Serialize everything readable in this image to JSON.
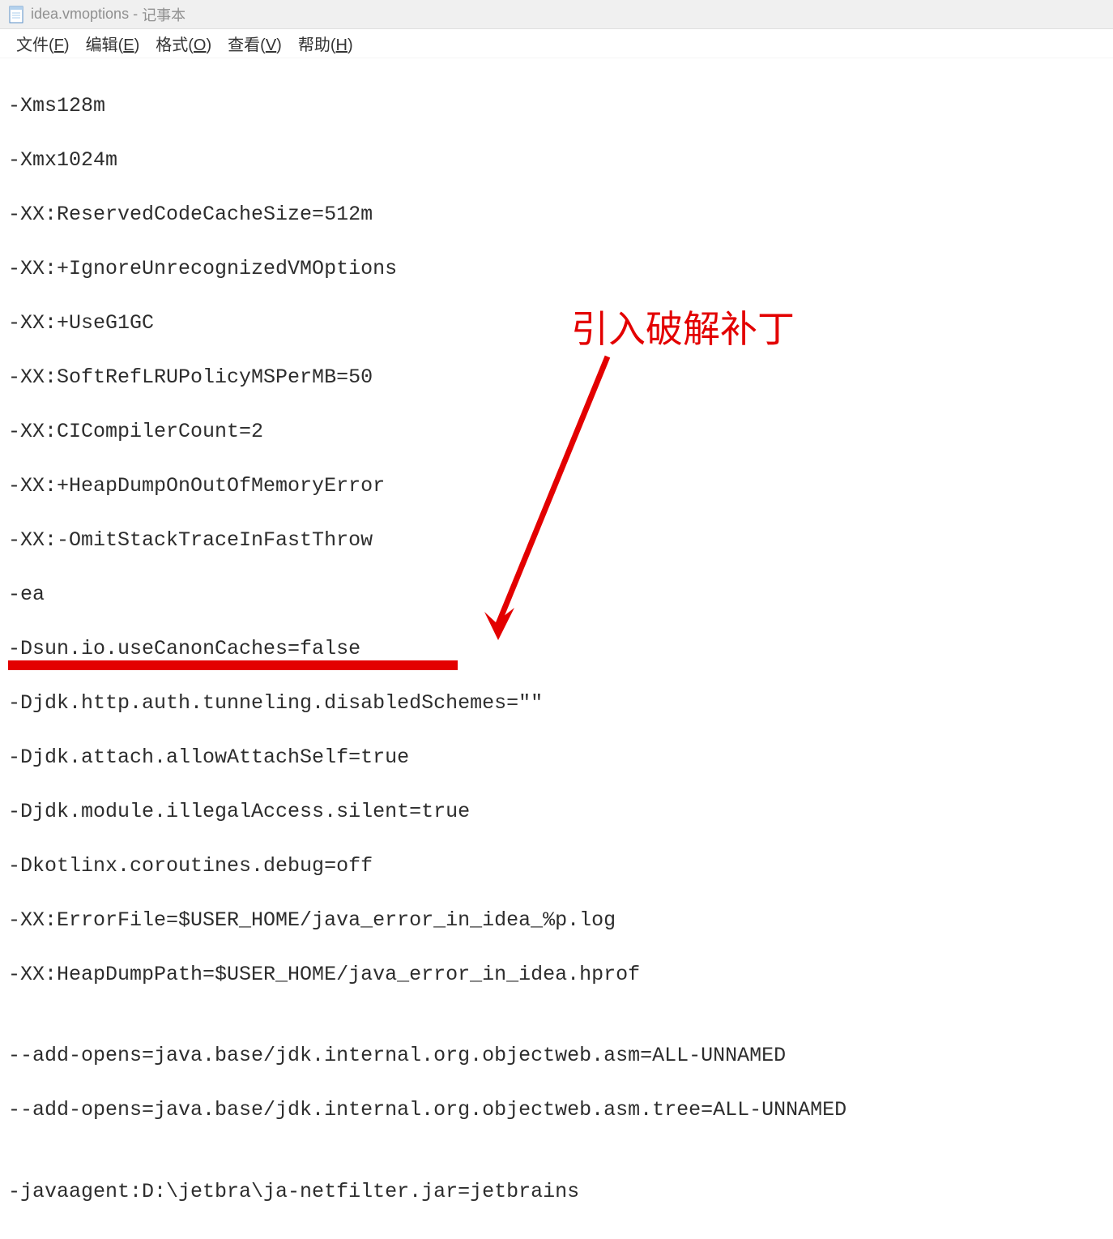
{
  "titlebar": {
    "filename": "idea.vmoptions",
    "appname": "记事本"
  },
  "menubar": {
    "file": {
      "label": "文件",
      "hotkey": "F"
    },
    "edit": {
      "label": "编辑",
      "hotkey": "E"
    },
    "format": {
      "label": "格式",
      "hotkey": "O"
    },
    "view": {
      "label": "查看",
      "hotkey": "V"
    },
    "help": {
      "label": "帮助",
      "hotkey": "H"
    }
  },
  "content": {
    "lines": [
      "-Xms128m",
      "-Xmx1024m",
      "-XX:ReservedCodeCacheSize=512m",
      "-XX:+IgnoreUnrecognizedVMOptions",
      "-XX:+UseG1GC",
      "-XX:SoftRefLRUPolicyMSPerMB=50",
      "-XX:CICompilerCount=2",
      "-XX:+HeapDumpOnOutOfMemoryError",
      "-XX:-OmitStackTraceInFastThrow",
      "-ea",
      "-Dsun.io.useCanonCaches=false",
      "-Djdk.http.auth.tunneling.disabledSchemes=\"\"",
      "-Djdk.attach.allowAttachSelf=true",
      "-Djdk.module.illegalAccess.silent=true",
      "-Dkotlinx.coroutines.debug=off",
      "-XX:ErrorFile=$USER_HOME/java_error_in_idea_%p.log",
      "-XX:HeapDumpPath=$USER_HOME/java_error_in_idea.hprof",
      "",
      "--add-opens=java.base/jdk.internal.org.objectweb.asm=ALL-UNNAMED",
      "--add-opens=java.base/jdk.internal.org.objectweb.asm.tree=ALL-UNNAMED",
      "",
      "-javaagent:D:\\jetbra\\ja-netfilter.jar=jetbrains"
    ]
  },
  "annotation": {
    "text": "引入破解补丁"
  }
}
